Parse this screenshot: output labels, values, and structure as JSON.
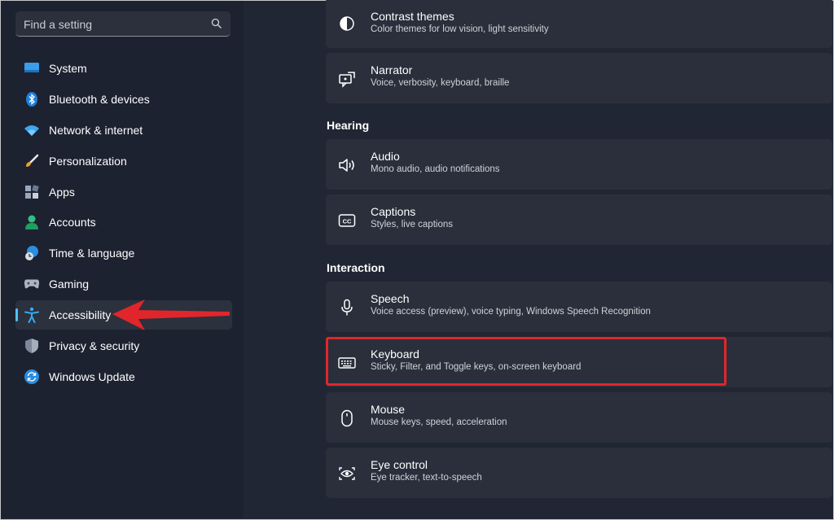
{
  "search": {
    "placeholder": "Find a setting"
  },
  "sidebar": {
    "items": [
      {
        "label": "System",
        "icon": "monitor-icon"
      },
      {
        "label": "Bluetooth & devices",
        "icon": "bluetooth-icon"
      },
      {
        "label": "Network & internet",
        "icon": "wifi-icon"
      },
      {
        "label": "Personalization",
        "icon": "brush-icon"
      },
      {
        "label": "Apps",
        "icon": "apps-icon"
      },
      {
        "label": "Accounts",
        "icon": "person-icon"
      },
      {
        "label": "Time & language",
        "icon": "globe-clock-icon"
      },
      {
        "label": "Gaming",
        "icon": "gamepad-icon"
      },
      {
        "label": "Accessibility",
        "icon": "accessibility-icon",
        "selected": true
      },
      {
        "label": "Privacy & security",
        "icon": "shield-icon"
      },
      {
        "label": "Windows Update",
        "icon": "update-icon"
      }
    ]
  },
  "main": {
    "contrast": {
      "title": "Contrast themes",
      "subtitle": "Color themes for low vision, light sensitivity"
    },
    "narrator": {
      "title": "Narrator",
      "subtitle": "Voice, verbosity, keyboard, braille"
    },
    "hearing_heading": "Hearing",
    "audio": {
      "title": "Audio",
      "subtitle": "Mono audio, audio notifications"
    },
    "captions": {
      "title": "Captions",
      "subtitle": "Styles, live captions"
    },
    "interaction_heading": "Interaction",
    "speech": {
      "title": "Speech",
      "subtitle": "Voice access (preview), voice typing, Windows Speech Recognition"
    },
    "keyboard": {
      "title": "Keyboard",
      "subtitle": "Sticky, Filter, and Toggle keys, on-screen keyboard"
    },
    "mouse": {
      "title": "Mouse",
      "subtitle": "Mouse keys, speed, acceleration"
    },
    "eye_control": {
      "title": "Eye control",
      "subtitle": "Eye tracker, text-to-speech"
    }
  },
  "colors": {
    "accent": "#4cc2ff",
    "annotation": "#e0262b"
  }
}
